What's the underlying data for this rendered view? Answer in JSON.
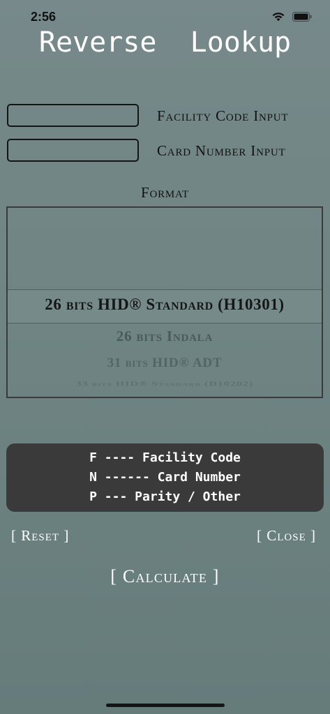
{
  "status_bar": {
    "time": "2:56",
    "icons": [
      "wifi-icon",
      "battery-icon"
    ]
  },
  "title": "Reverse  Lookup",
  "inputs": {
    "facility_code": {
      "label": "Facility Code Input",
      "value": "",
      "placeholder": ""
    },
    "card_number": {
      "label": "Card Number Input",
      "value": "",
      "placeholder": ""
    }
  },
  "format": {
    "label": "Format",
    "selected": "26 bits HID® Standard (H10301)",
    "options_below": [
      "26 bits Indala",
      "31 bits HID® ADT",
      "33 bits HID® Standard (D10202)"
    ]
  },
  "legend": {
    "lines": [
      "F ---- Facility Code",
      "N ------ Card Number",
      "P --- Parity / Other"
    ]
  },
  "buttons": {
    "reset": "[ Reset ]",
    "close": "[ Close ]",
    "calculate": "[ Calculate ]"
  },
  "colors": {
    "background_top": "#77898a",
    "background_bottom": "#667c7b",
    "legend_bg": "#3a3a3a",
    "text_dark": "#111111",
    "text_light": "#ffffff"
  }
}
